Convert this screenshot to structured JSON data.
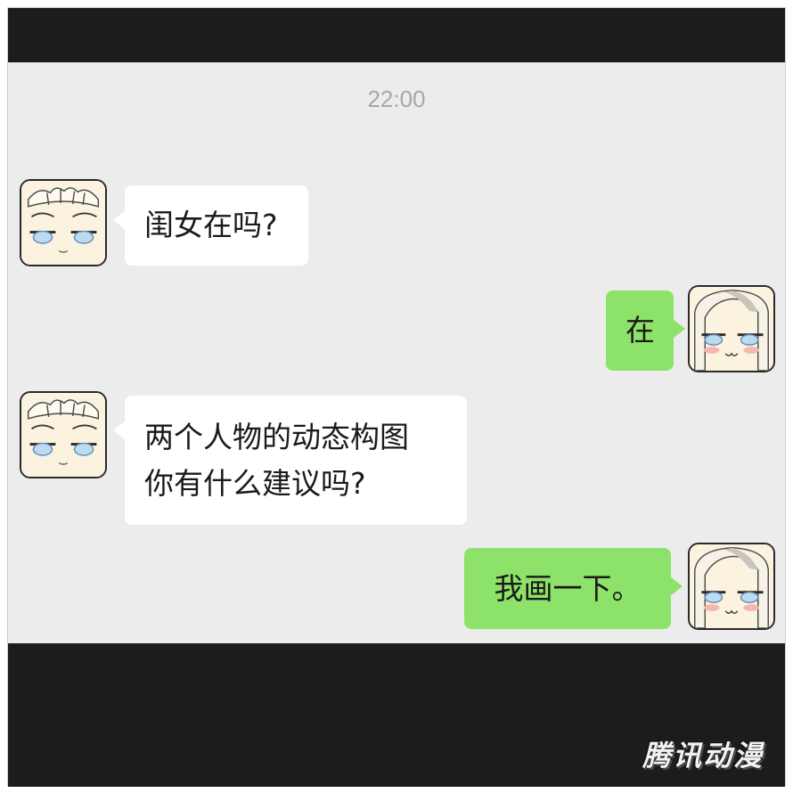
{
  "chat": {
    "timestamp": "22:00",
    "messages": [
      {
        "side": "left",
        "lines": [
          "闺女在吗?"
        ],
        "avatar": "father-avatar"
      },
      {
        "side": "right",
        "lines": [
          "在"
        ],
        "avatar": "daughter-avatar"
      },
      {
        "side": "left",
        "lines": [
          "两个人物的动态构图",
          "你有什么建议吗?"
        ],
        "avatar": "father-avatar"
      },
      {
        "side": "right",
        "lines": [
          "我画一下。"
        ],
        "avatar": "daughter-avatar"
      }
    ]
  },
  "colors": {
    "frame": "#1c1c1c",
    "chat_background": "#ececec",
    "incoming_bubble": "#ffffff",
    "outgoing_bubble": "#8de36a",
    "timestamp": "#a8a8a8"
  },
  "watermark": "腾讯动漫"
}
